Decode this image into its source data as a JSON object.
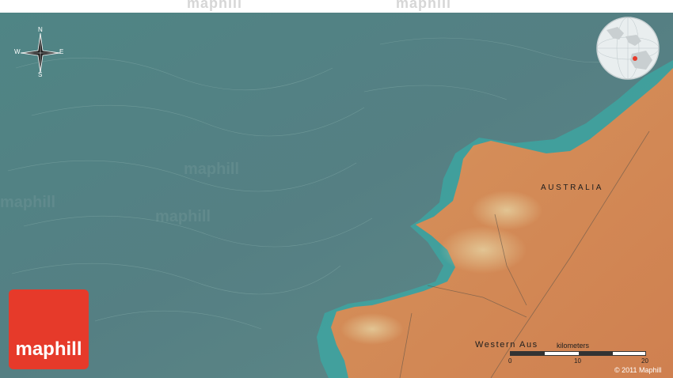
{
  "watermark": {
    "text": "maphill"
  },
  "map": {
    "country_label": "AUSTRALIA",
    "region_label": "Western Aus"
  },
  "compass": {
    "north": "N",
    "south": "S",
    "east": "E",
    "west": "W"
  },
  "scale": {
    "unit_label": "kilometers",
    "ticks": [
      "0",
      "10",
      "20"
    ]
  },
  "copyright": "© 2011 Maphill",
  "logo": {
    "text": "maphill"
  },
  "colors": {
    "ocean": "#4f8585",
    "land": "#d98852",
    "shallow_water": "#2fb8b0",
    "logo": "#e63a2a"
  }
}
